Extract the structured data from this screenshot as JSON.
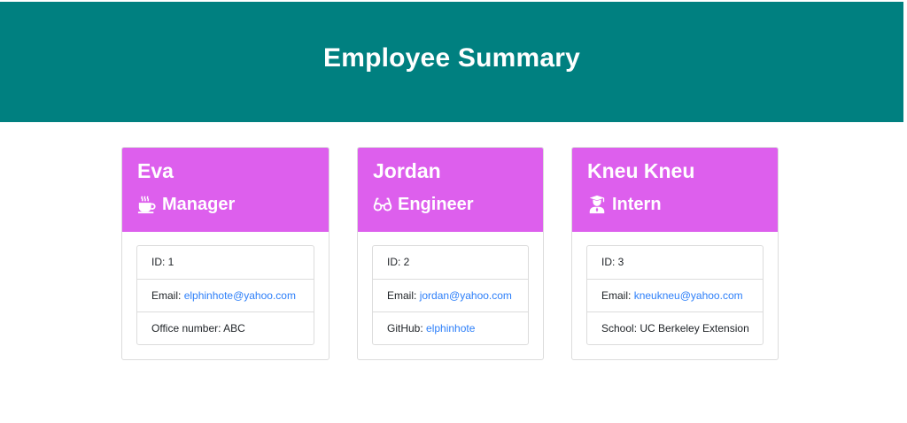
{
  "header": {
    "title": "Employee Summary"
  },
  "employees": [
    {
      "name": "Eva",
      "role": "Manager",
      "role_icon": "coffee-icon",
      "id_label": "ID: 1",
      "email_prefix": "Email: ",
      "email": "elphinhote@yahoo.com",
      "extra_prefix": "Office number: ",
      "extra_value": "ABC"
    },
    {
      "name": "Jordan",
      "role": "Engineer",
      "role_icon": "glasses-icon",
      "id_label": "ID: 2",
      "email_prefix": "Email: ",
      "email": "jordan@yahoo.com",
      "extra_prefix": "GitHub: ",
      "extra_value": "elphinhote"
    },
    {
      "name": "Kneu Kneu",
      "role": "Intern",
      "role_icon": "graduate-icon",
      "id_label": "ID: 3",
      "email_prefix": "Email: ",
      "email": "kneukneu@yahoo.com",
      "extra_prefix": "School: ",
      "extra_value": "UC Berkeley Extension"
    }
  ],
  "colors": {
    "header_bg": "#008080",
    "card_header_bg": "#dd5fed",
    "link": "#2d7ff9"
  }
}
